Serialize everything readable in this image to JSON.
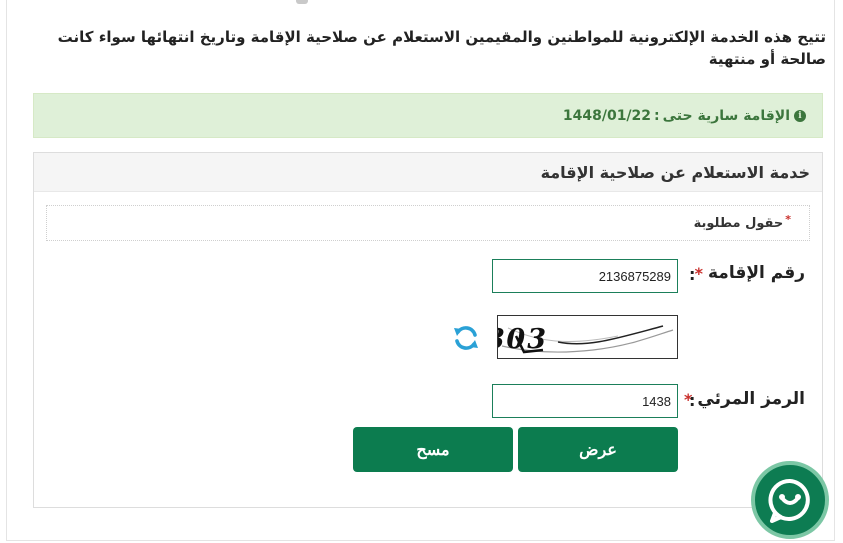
{
  "intro_text": "تتيح هذه الخدمة الإلكترونية للمواطنين والمقيمين الاستعلام عن صلاحية الإقامة وتاريخ انتهائها سواء كانت صالحة أو منتهية",
  "alert": {
    "label": "الإقامة سارية حتى",
    "separator": ":",
    "date": "1448/01/22",
    "icon": "info-icon",
    "color": "#3c763d"
  },
  "panel": {
    "title": "خدمة الاستعلام عن صلاحية الإقامة",
    "required_note": "حقول مطلوبة",
    "required_marker": "*"
  },
  "form": {
    "iqama_label": "رقم الإقامة",
    "iqama_value": "2136875289",
    "captcha_text": "3803",
    "captcha_label": "الرمز المرئي",
    "captcha_value": "1438",
    "required_marker": "*",
    "colon": ":"
  },
  "buttons": {
    "search_label": "عرض",
    "clear_label": "مسح"
  },
  "colors": {
    "brand_green": "#0c7c4f",
    "required_red": "#c9302c",
    "alert_bg": "#dff0d8"
  },
  "icons": {
    "refresh": "refresh-icon",
    "chat": "chat-support-icon"
  }
}
